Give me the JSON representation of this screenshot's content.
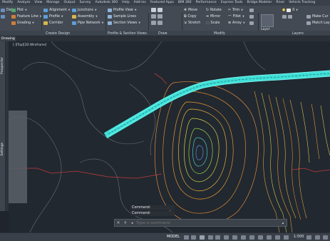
{
  "menubar": [
    "Modify",
    "Analyze",
    "View",
    "Manage",
    "Output",
    "Survey",
    "Autodesk 360",
    "Help",
    "Add-ins",
    "Featured Apps",
    "BIM 360",
    "Performance",
    "Express Tools",
    "Bridge Modeler",
    "River",
    "Vehicle Tracking"
  ],
  "ribbon": {
    "data_label": "Data",
    "plot_label": "Plot",
    "alignment_label": "Alignment",
    "junctions_label": "Junctions",
    "profile_view_label": "Profile View",
    "feature_line_label": "Feature Line",
    "profile_label": "Profile",
    "assembly_label": "Assembly",
    "sample_lines_label": "Sample Lines",
    "grading_label": "Grading",
    "corridor_label": "Corridor",
    "pipe_network_label": "Pipe Network",
    "section_views_label": "Section Views",
    "move_label": "Move",
    "rotate_label": "Rotate",
    "trim_label": "Trim",
    "copy_label": "Copy",
    "mirror_label": "Mirror",
    "fillet_label": "Fillet",
    "stretch_label": "Stretch",
    "scale_label": "Scale",
    "array_label": "Array",
    "layer_properties_label": "Layer Properties",
    "make_current_label": "Make Cur",
    "match_layer_label": "Match Lay",
    "layer_value": "0"
  },
  "panels": {
    "create_design": "Create Design",
    "profile_section": "Profile & Section Views",
    "draw": "Draw",
    "modify": "Modify",
    "layers": "Layers"
  },
  "file_tab": "Drawing",
  "view_label": "[-][Top][2D Wireframe]",
  "command_history": [
    "Command:",
    "Command:"
  ],
  "command_placeholder": "Type a command",
  "status": {
    "model": "MODEL",
    "scale": "1:500"
  },
  "palette_labels": {
    "prospector": "Prospector",
    "settings": "Settings"
  },
  "colors": {
    "corridor": "#3fe0d8",
    "canvas_bg": "#212830",
    "ribbon_bg": "#444a53"
  }
}
